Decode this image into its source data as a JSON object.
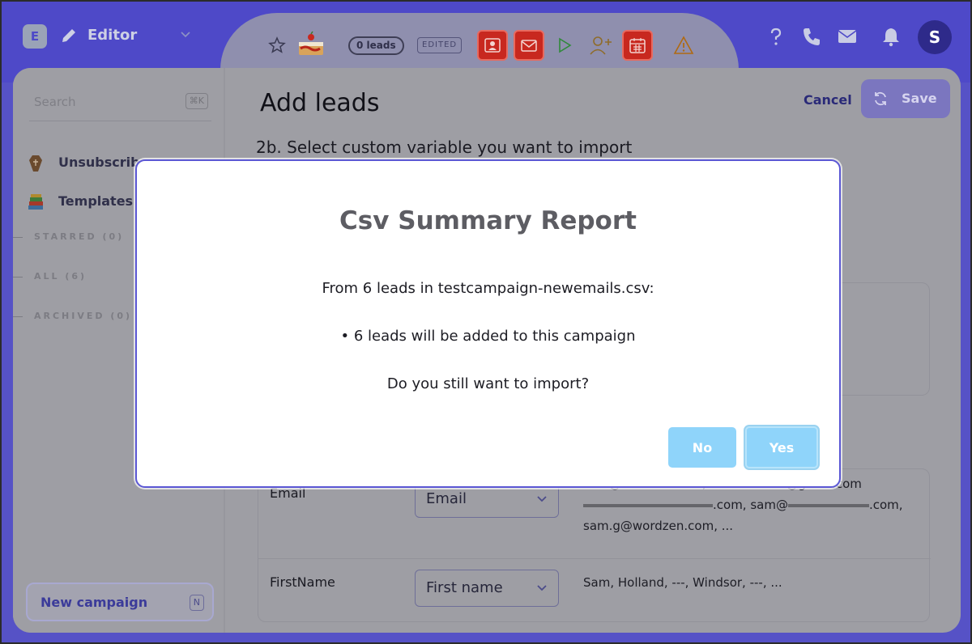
{
  "header": {
    "logo_letter": "E",
    "mode_label": "Editor",
    "leads_count": "0 leads",
    "edited_badge": "EDITED",
    "avatar_letter": "S",
    "colors": {
      "topbar": "#4e49c8",
      "alert_red": "#c8281f"
    }
  },
  "sidebar": {
    "search_placeholder": "Search",
    "search_shortcut": "⌘K",
    "items": [
      {
        "label": "Unsubscribe",
        "icon": "coffin-icon"
      },
      {
        "label": "Templates",
        "icon": "books-icon"
      }
    ],
    "sections": [
      "STARRED (0)",
      "ALL (6)",
      "ARCHIVED (0)"
    ],
    "new_campaign": {
      "label": "New campaign",
      "shortcut": "N"
    }
  },
  "main": {
    "title": "Add leads",
    "cancel_label": "Cancel",
    "save_label": "Save",
    "subheading": "2b. Select custom variable you want to import",
    "mapping": [
      {
        "field": "Email",
        "selected": "Email",
        "samples": [
          "sam@worazen.com,",
          "@gmail.com",
          ".com, sam@",
          ".com,",
          "sam.g@wordzen.com, ..."
        ]
      },
      {
        "field": "FirstName",
        "selected": "First name",
        "samples": [
          "Sam, Holland, ---, Windsor, ---, ..."
        ]
      }
    ]
  },
  "modal": {
    "title": "Csv Summary Report",
    "line1": "From 6 leads in testcampaign-newemails.csv:",
    "line2": "• 6 leads will be added to this campaign",
    "line3": "Do you still want to import?",
    "no_label": "No",
    "yes_label": "Yes",
    "button_color": "#8fd4fa"
  }
}
